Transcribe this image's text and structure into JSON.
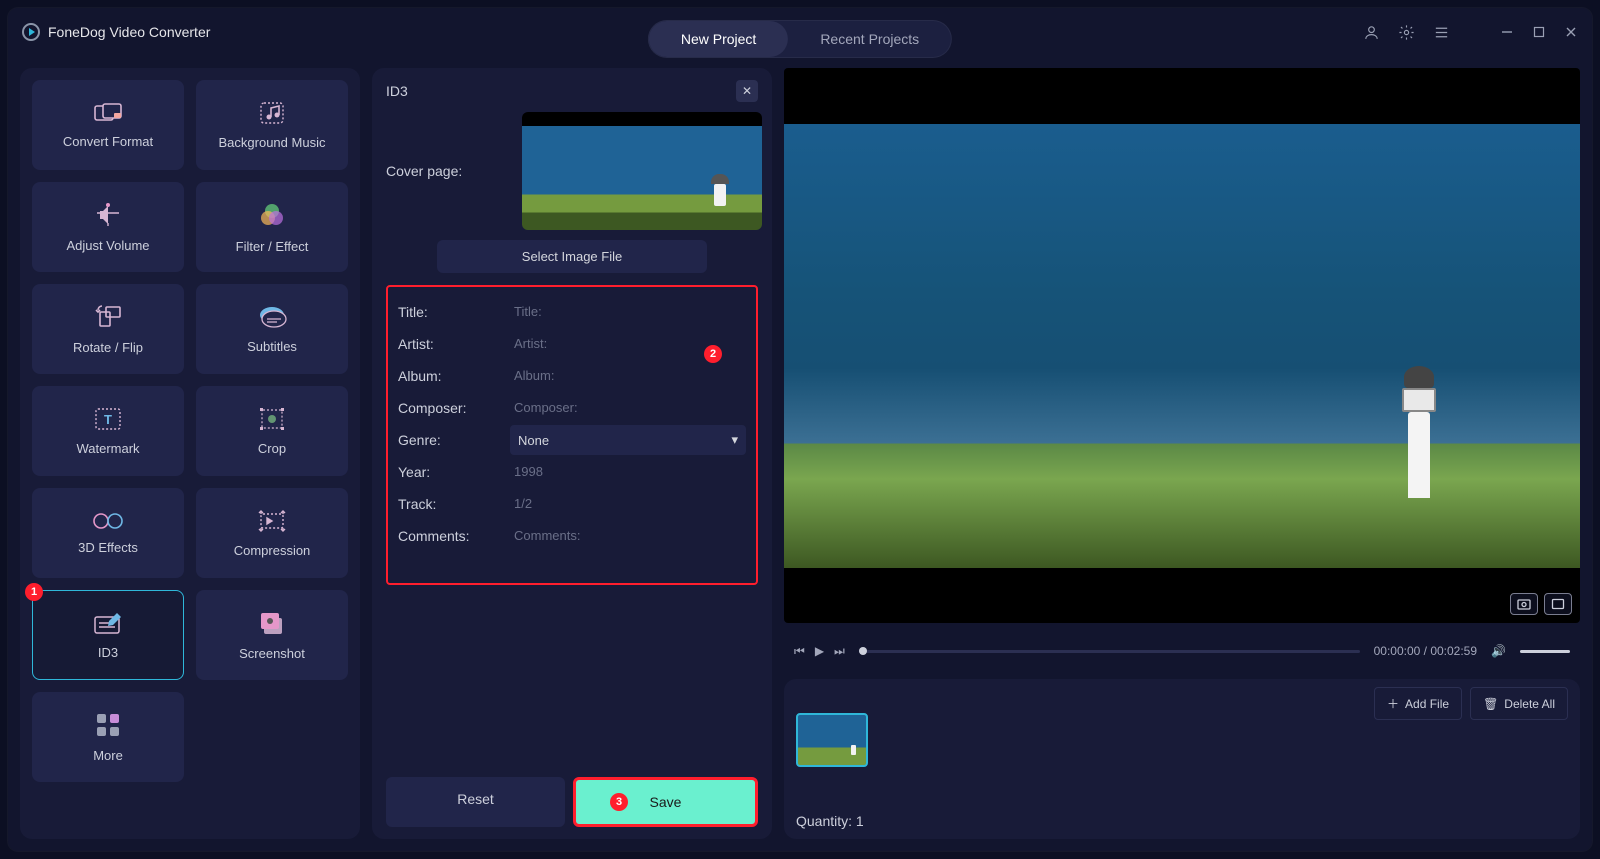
{
  "app": {
    "title": "FoneDog Video Converter"
  },
  "tabs": {
    "new_project": "New Project",
    "recent_projects": "Recent Projects"
  },
  "sidebar": {
    "items": [
      {
        "label": "Convert Format",
        "icon": "convert"
      },
      {
        "label": "Background Music",
        "icon": "music"
      },
      {
        "label": "Adjust Volume",
        "icon": "volume"
      },
      {
        "label": "Filter / Effect",
        "icon": "filter"
      },
      {
        "label": "Rotate / Flip",
        "icon": "rotate"
      },
      {
        "label": "Subtitles",
        "icon": "subtitles"
      },
      {
        "label": "Watermark",
        "icon": "watermark"
      },
      {
        "label": "Crop",
        "icon": "crop"
      },
      {
        "label": "3D Effects",
        "icon": "3d"
      },
      {
        "label": "Compression",
        "icon": "compress"
      },
      {
        "label": "ID3",
        "icon": "id3"
      },
      {
        "label": "Screenshot",
        "icon": "screenshot"
      },
      {
        "label": "More",
        "icon": "more"
      }
    ]
  },
  "annotations": {
    "badge1": "1",
    "badge2": "2",
    "badge3": "3"
  },
  "id3": {
    "header": "ID3",
    "cover_label": "Cover page:",
    "select_image": "Select Image File",
    "fields": {
      "title_label": "Title:",
      "title_ph": "Title:",
      "artist_label": "Artist:",
      "artist_ph": "Artist:",
      "album_label": "Album:",
      "album_ph": "Album:",
      "composer_label": "Composer:",
      "composer_ph": "Composer:",
      "genre_label": "Genre:",
      "genre_value": "None",
      "year_label": "Year:",
      "year_ph": "1998",
      "track_label": "Track:",
      "track_ph": "1/2",
      "comments_label": "Comments:",
      "comments_ph": "Comments:"
    },
    "reset": "Reset",
    "save": "Save"
  },
  "player": {
    "time": "00:00:00 / 00:02:59"
  },
  "filebar": {
    "add_file": "Add File",
    "delete_all": "Delete All",
    "quantity": "Quantity: 1"
  }
}
